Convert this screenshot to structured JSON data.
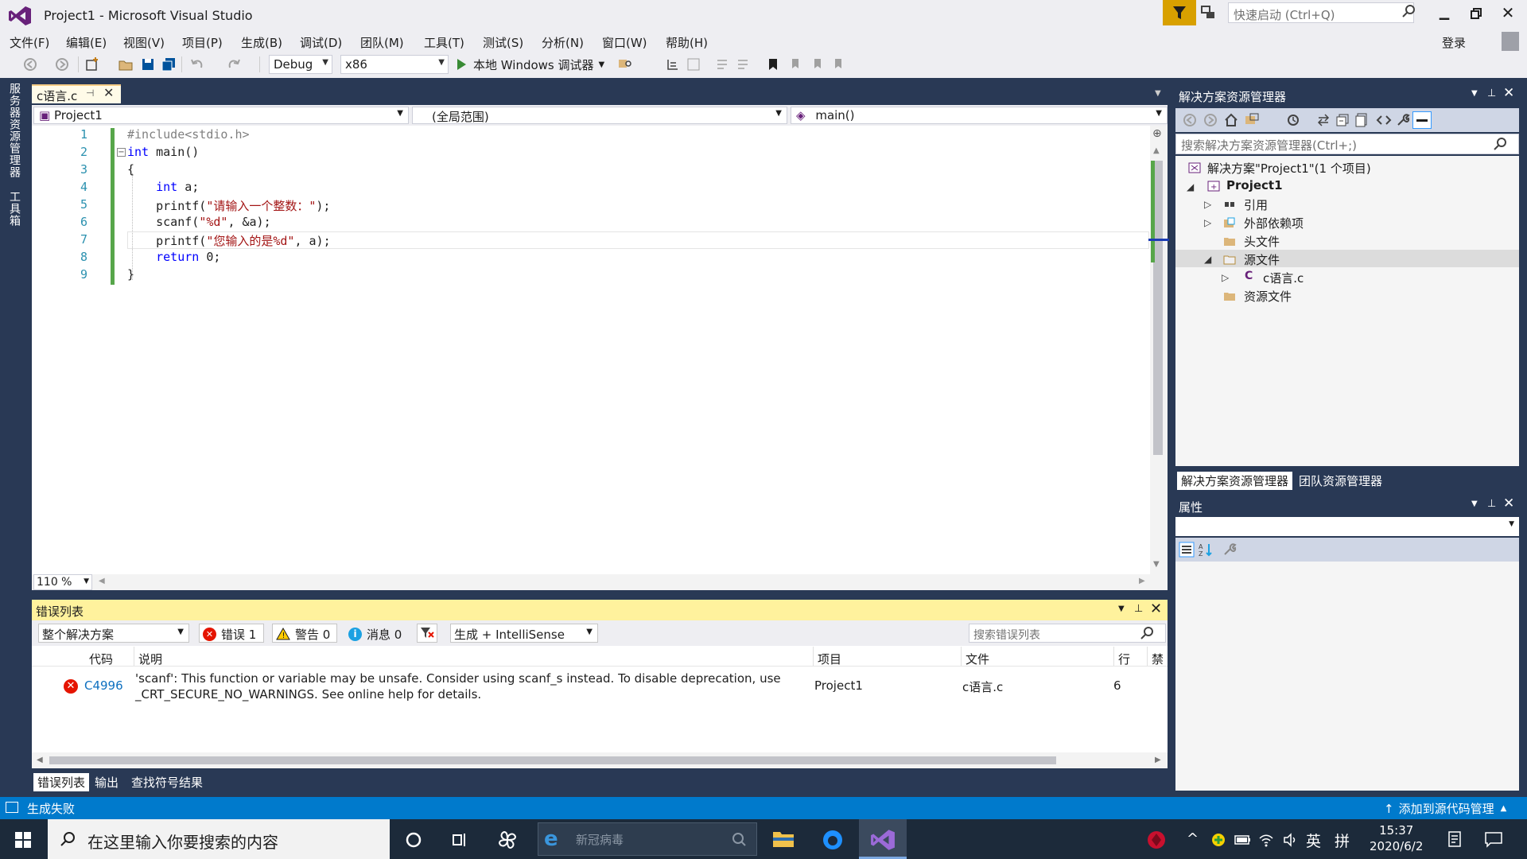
{
  "window": {
    "title": "Project1 - Microsoft Visual Studio"
  },
  "quick_launch": {
    "placeholder": "快速启动 (Ctrl+Q)"
  },
  "menu": [
    "文件(F)",
    "编辑(E)",
    "视图(V)",
    "项目(P)",
    "生成(B)",
    "调试(D)",
    "团队(M)",
    "工具(T)",
    "测试(S)",
    "分析(N)",
    "窗口(W)",
    "帮助(H)"
  ],
  "login_label": "登录",
  "toolbar": {
    "config": "Debug",
    "platform": "x86",
    "run_label": "本地 Windows 调试器"
  },
  "side_tabs": [
    "服务器资源管理器",
    "工具箱"
  ],
  "editor": {
    "tab_label": "c语言.c",
    "nav_project": "Project1",
    "nav_scope": "(全局范围)",
    "nav_member": "main()",
    "zoom": "110 %",
    "line_numbers": [
      "1",
      "2",
      "3",
      "4",
      "5",
      "6",
      "7",
      "8",
      "9"
    ],
    "code": [
      "#include<stdio.h>",
      "int main()",
      "{",
      "    int a;",
      "    printf(\"请输入一个整数：\");",
      "    scanf(\"%d\", &a);",
      "    printf(\"您输入的是%d\", a);",
      "    return 0;",
      "}"
    ]
  },
  "error_list": {
    "title": "错误列表",
    "scope": "整个解决方案",
    "errors_btn": "错误 1",
    "warnings_btn": "警告 0",
    "messages_btn": "消息 0",
    "build_filter": "生成 + IntelliSense",
    "search_placeholder": "搜索错误列表",
    "columns": [
      "代码",
      "说明",
      "项目",
      "文件",
      "行",
      "禁"
    ],
    "rows": [
      {
        "code": "C4996",
        "description": "'scanf': This function or variable may be unsafe. Consider using scanf_s instead. To disable deprecation, use _CRT_SECURE_NO_WARNINGS. See online help for details.",
        "project": "Project1",
        "file": "c语言.c",
        "line": "6"
      }
    ]
  },
  "bottom_tabs": [
    "错误列表",
    "输出",
    "查找符号结果"
  ],
  "solution_explorer": {
    "title": "解决方案资源管理器",
    "search_placeholder": "搜索解决方案资源管理器(Ctrl+;)",
    "tree": [
      "解决方案\"Project1\"(1 个项目)",
      "Project1",
      "引用",
      "外部依赖项",
      "头文件",
      "源文件",
      "c语言.c",
      "资源文件"
    ],
    "tabs": [
      "解决方案资源管理器",
      "团队资源管理器"
    ]
  },
  "properties": {
    "title": "属性"
  },
  "status": {
    "left": "生成失败",
    "right": "添加到源代码管理"
  },
  "taskbar": {
    "search_placeholder": "在这里输入你要搜索的内容",
    "browser_search": "新冠病毒",
    "ime": "英",
    "ime2": "拼",
    "time": "15:37",
    "date": "2020/6/2"
  },
  "colors": {
    "accent": "#007acc",
    "vs_purple": "#68217a",
    "error_red": "#e51400"
  }
}
